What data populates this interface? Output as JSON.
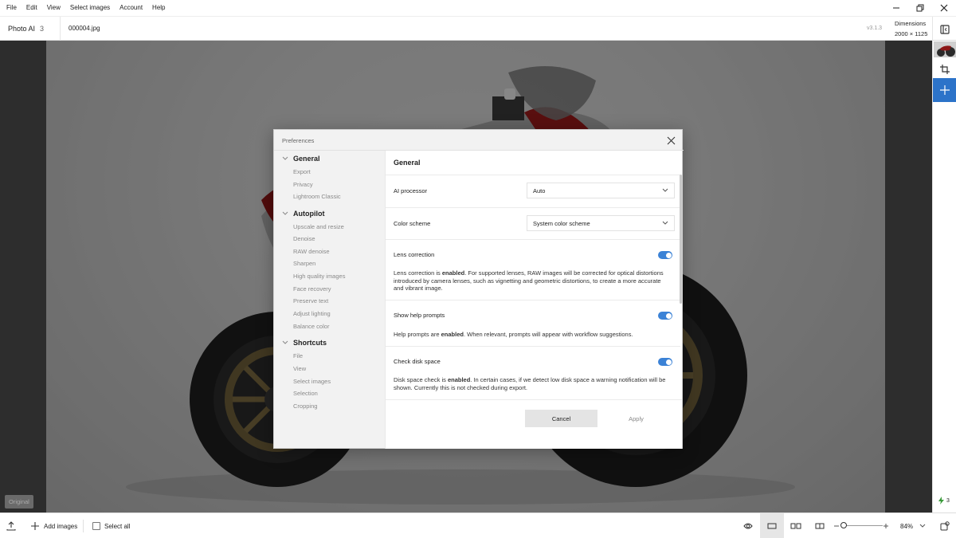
{
  "menu": [
    "File",
    "Edit",
    "View",
    "Select images",
    "Account",
    "Help"
  ],
  "header": {
    "app_name": "Photo AI",
    "app_count": "3",
    "filename": "000004.jpg",
    "version": "v3.1.3",
    "dimensions_label": "Dimensions",
    "dimensions_value": "2000 × 1125"
  },
  "canvas": {
    "badge": "Original"
  },
  "right_strip": {
    "credits": "3"
  },
  "bottom": {
    "add_images": "Add images",
    "select_all": "Select all",
    "zoom": "84%"
  },
  "dialog": {
    "title": "Preferences",
    "sidebar": {
      "general": {
        "title": "General",
        "items": [
          "Export",
          "Privacy",
          "Lightroom Classic"
        ]
      },
      "autopilot": {
        "title": "Autopilot",
        "items": [
          "Upscale and resize",
          "Denoise",
          "RAW denoise",
          "Sharpen",
          "High quality images",
          "Face recovery",
          "Preserve text",
          "Adjust lighting",
          "Balance color"
        ]
      },
      "shortcuts": {
        "title": "Shortcuts",
        "items": [
          "File",
          "View",
          "Select images",
          "Selection",
          "Cropping"
        ]
      }
    },
    "content": {
      "title": "General",
      "ai_processor": {
        "label": "AI processor",
        "value": "Auto"
      },
      "color_scheme": {
        "label": "Color scheme",
        "value": "System color scheme"
      },
      "lens_correction": {
        "label": "Lens correction",
        "on": true,
        "desc_pre": "Lens correction is ",
        "desc_bold": "enabled",
        "desc_post": ". For supported lenses, RAW images will be corrected for optical distortions introduced by camera lenses, such as vignetting and geometric distortions, to create a more accurate and vibrant image."
      },
      "help_prompts": {
        "label": "Show help prompts",
        "on": true,
        "desc_pre": "Help prompts are ",
        "desc_bold": "enabled",
        "desc_post": ". When relevant, prompts will appear with workflow suggestions."
      },
      "disk_space": {
        "label": "Check disk space",
        "on": true,
        "desc_pre": "Disk space check is ",
        "desc_bold": "enabled",
        "desc_post": ". In certain cases, if we detect low disk space a warning notification will be shown. Currently this is not checked during export."
      }
    },
    "buttons": {
      "cancel": "Cancel",
      "apply": "Apply"
    }
  },
  "colors": {
    "accent": "#2c73c9",
    "toggle_on": "#3b82d6"
  }
}
